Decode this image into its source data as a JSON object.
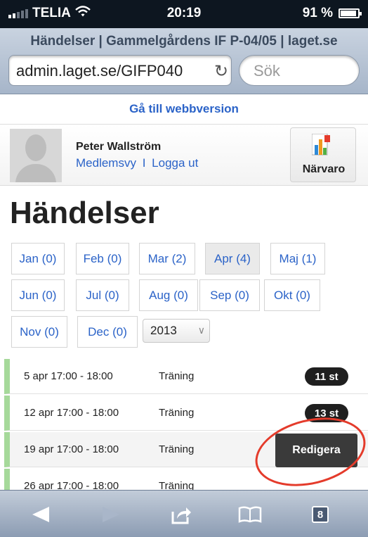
{
  "status": {
    "carrier": "TELIA",
    "time": "20:19",
    "battery": "91 %",
    "battery_level": 0.91
  },
  "browser": {
    "page_title": "Händelser | Gammelgårdens IF P-04/05 | laget.se",
    "url": "admin.laget.se/GIFP040",
    "search_placeholder": "Sök"
  },
  "page": {
    "web_version_link": "Gå till webbversion",
    "user": {
      "name": "Peter Wallström",
      "member_view": "Medlemsvy",
      "separator": "I",
      "logout": "Logga ut"
    },
    "attendance_label": "Närvaro",
    "heading": "Händelser",
    "months": [
      {
        "label": "Jan (0)",
        "active": false
      },
      {
        "label": "Feb (0)",
        "active": false
      },
      {
        "label": "Mar (2)",
        "active": false
      },
      {
        "label": "Apr (4)",
        "active": true
      },
      {
        "label": "Maj (1)",
        "active": false
      },
      {
        "label": "Jun (0)",
        "active": false
      },
      {
        "label": "Jul (0)",
        "active": false
      },
      {
        "label": "Aug (0)",
        "active": false
      },
      {
        "label": "Sep (0)",
        "active": false
      },
      {
        "label": "Okt (0)",
        "active": false
      },
      {
        "label": "Nov (0)",
        "active": false
      },
      {
        "label": "Dec (0)",
        "active": false
      }
    ],
    "year": "2013",
    "events": [
      {
        "date": "5 apr 17:00 - 18:00",
        "type": "Träning",
        "count": "11 st"
      },
      {
        "date": "12 apr 17:00 - 18:00",
        "type": "Träning",
        "count": "13 st"
      },
      {
        "date": "19 apr 17:00 - 18:00",
        "type": "Träning",
        "count": ""
      },
      {
        "date": "26 apr 17:00 - 18:00",
        "type": "Träning",
        "count": ""
      }
    ],
    "edit_button": "Redigera"
  },
  "toolbar": {
    "tabs_count": "8"
  },
  "colors": {
    "link": "#2b63c8",
    "event_marker": "#a6d99a",
    "annotation": "#e43b2b"
  }
}
